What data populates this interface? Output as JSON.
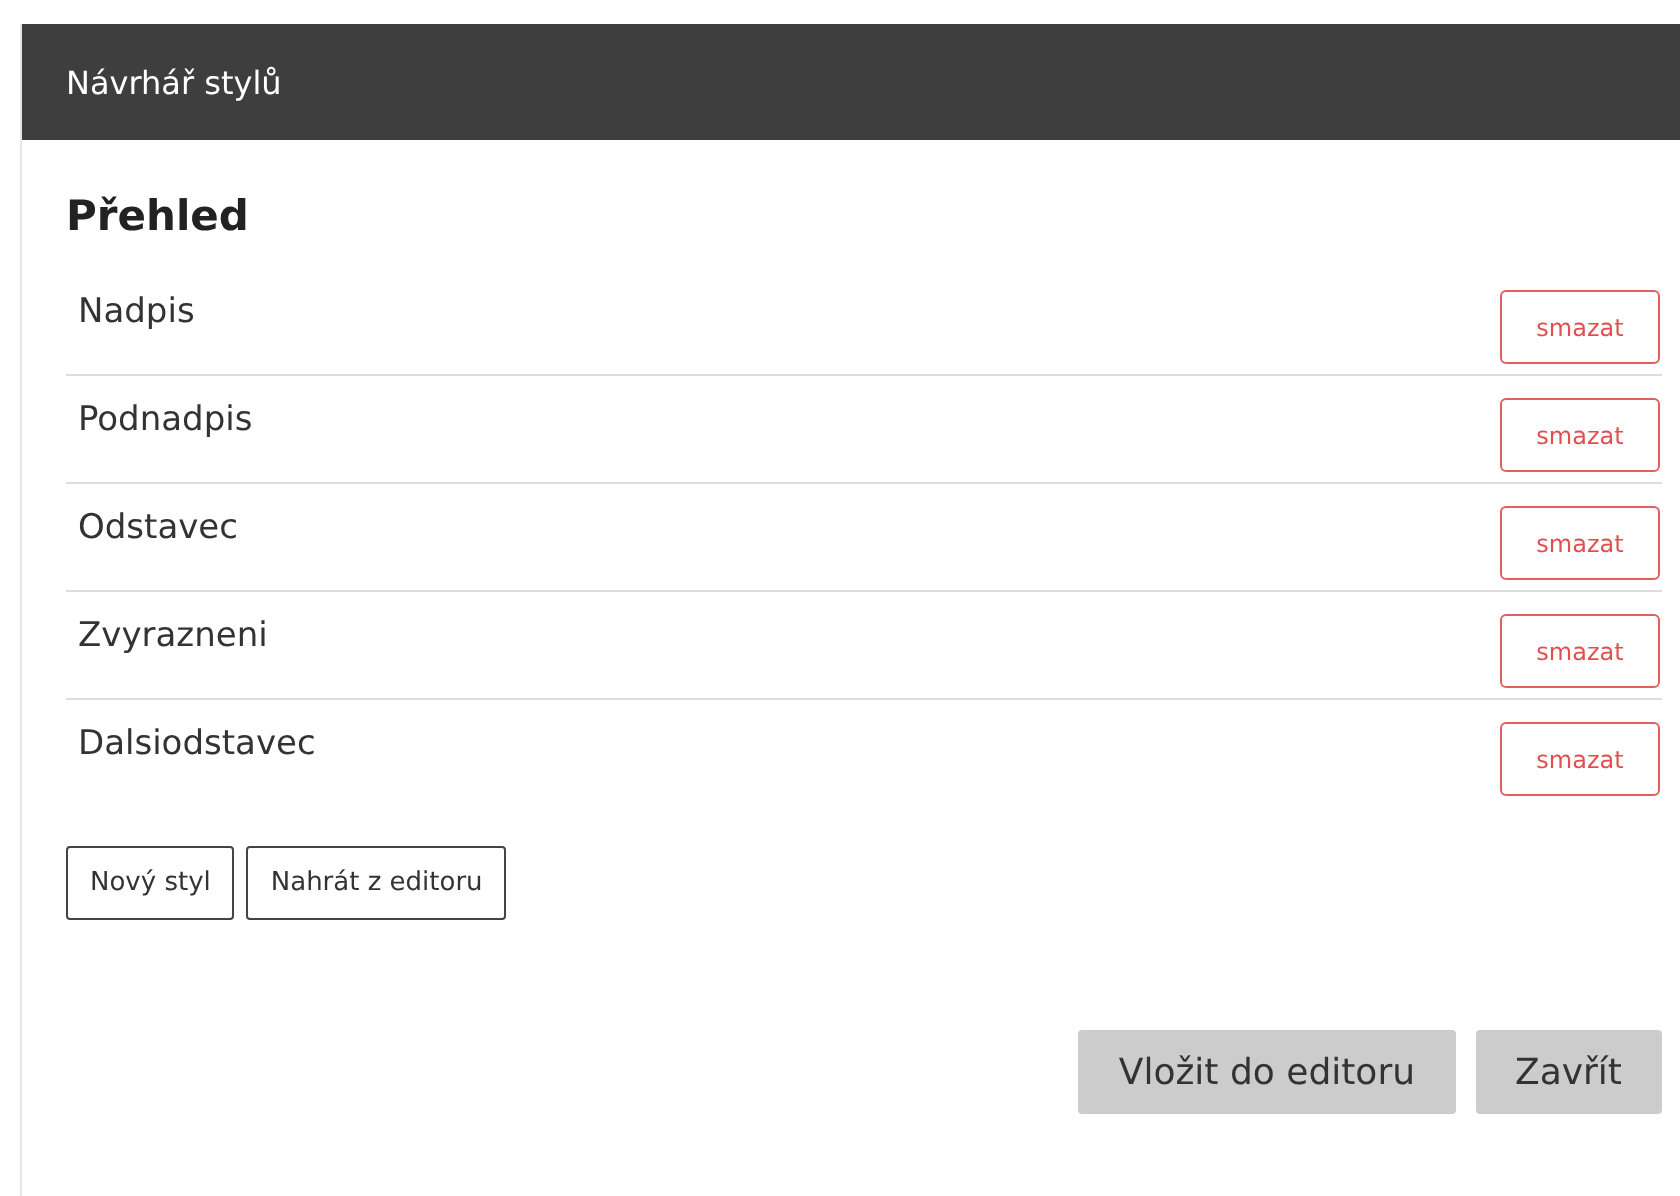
{
  "window": {
    "title": "Návrhář stylů"
  },
  "heading": "Přehled",
  "styles": [
    {
      "name": "Nadpis",
      "action": "smazat"
    },
    {
      "name": "Podnadpis",
      "action": "smazat"
    },
    {
      "name": "Odstavec",
      "action": "smazat"
    },
    {
      "name": "Zvyrazneni",
      "action": "smazat"
    },
    {
      "name": "Dalsiodstavec",
      "action": "smazat"
    }
  ],
  "tools": [
    "Nový styl",
    "Nahrát z editoru"
  ],
  "footer_buttons": [
    "Vložit do editoru",
    "Zavřít"
  ]
}
